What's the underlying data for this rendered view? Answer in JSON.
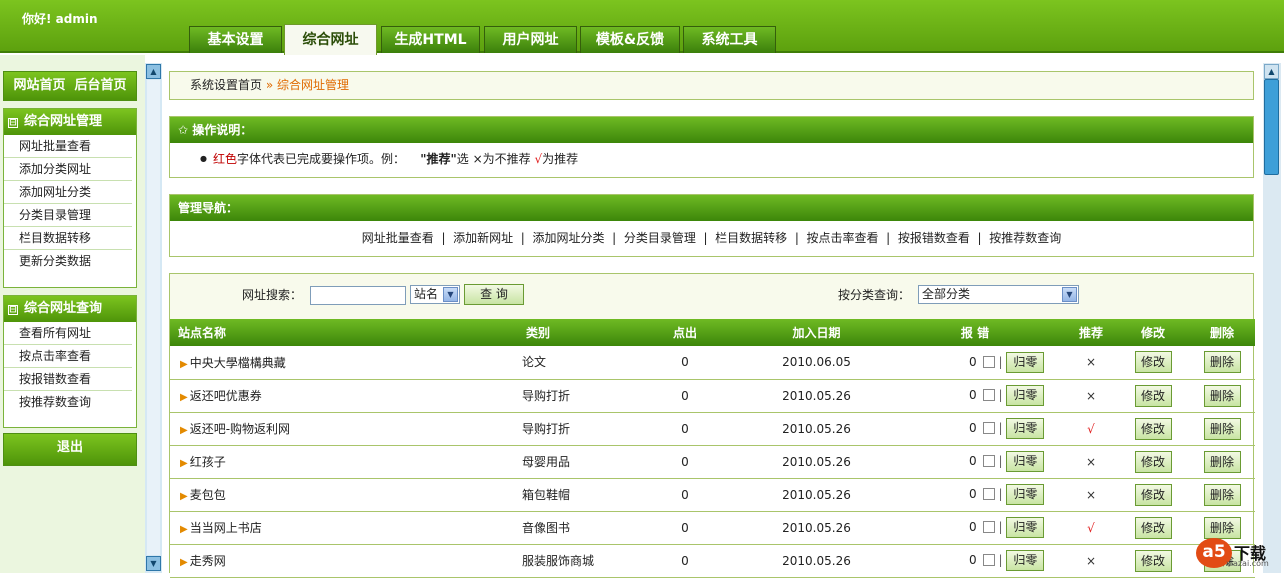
{
  "header": {
    "greeting": "你好! admin",
    "tabs": [
      {
        "label": "基本设置",
        "active": false
      },
      {
        "label": "综合网址",
        "active": true
      },
      {
        "label": "生成HTML",
        "active": false
      },
      {
        "label": "用户网址",
        "active": false
      },
      {
        "label": "模板&反馈",
        "active": false
      },
      {
        "label": "系统工具",
        "active": false
      }
    ]
  },
  "sidebar": {
    "top_links": {
      "site_home": "网站首页",
      "admin_home": "后台首页"
    },
    "group1": {
      "title": "综合网址管理",
      "toggle": "⊟",
      "items": [
        "网址批量查看",
        "添加分类网址",
        "添加网址分类",
        "分类目录管理",
        "栏目数据转移",
        "更新分类数据"
      ]
    },
    "group2": {
      "title": "综合网址查询",
      "toggle": "⊟",
      "items": [
        "查看所有网址",
        "按点击率查看",
        "按报错数查看",
        "按推荐数查询"
      ]
    },
    "logout": "退出"
  },
  "breadcrumb": {
    "home": "系统设置首页",
    "sep": "»",
    "current": "综合网址管理"
  },
  "instructions": {
    "title": "✩ 操作说明：",
    "bullet": "●",
    "red_word": "红色",
    "text1": "字体代表已完成要操作项。例：",
    "bold_word": "\"推荐\"",
    "text2": "选 ×为不推荐",
    "check": "√",
    "text3": "为推荐"
  },
  "manage_nav": {
    "title": "管理导航：",
    "sep": "|",
    "links": [
      "网址批量查看",
      "添加新网址",
      "添加网址分类",
      "分类目录管理",
      "栏目数据转移",
      "按点击率查看",
      "按报错数查看",
      "按推荐数查询"
    ]
  },
  "search": {
    "label": "网址搜索：",
    "input_value": "",
    "field_select": "站名",
    "button": "查 询",
    "category_label": "按分类查询：",
    "category_select": "全部分类"
  },
  "table": {
    "columns": [
      "站点名称",
      "类别",
      "点出",
      "加入日期",
      "报 错",
      "推荐",
      "修改",
      "删除"
    ],
    "reset_label": "归零",
    "edit_label": "修改",
    "delete_label": "删除",
    "bar_char": "|",
    "rows": [
      {
        "name": "中央大學檔構典藏",
        "category": "论文",
        "clicks": "0",
        "date": "2010.06.05",
        "errors": "0",
        "recommend": "×",
        "rec_color": "#333333"
      },
      {
        "name": "返还吧优惠券",
        "category": "导购打折",
        "clicks": "0",
        "date": "2010.05.26",
        "errors": "0",
        "recommend": "×",
        "rec_color": "#333333"
      },
      {
        "name": "返还吧-购物返利网",
        "category": "导购打折",
        "clicks": "0",
        "date": "2010.05.26",
        "errors": "0",
        "recommend": "√",
        "rec_color": "#e02020"
      },
      {
        "name": "红孩子",
        "category": "母婴用品",
        "clicks": "0",
        "date": "2010.05.26",
        "errors": "0",
        "recommend": "×",
        "rec_color": "#333333"
      },
      {
        "name": "麦包包",
        "category": "箱包鞋帽",
        "clicks": "0",
        "date": "2010.05.26",
        "errors": "0",
        "recommend": "×",
        "rec_color": "#333333"
      },
      {
        "name": "当当网上书店",
        "category": "音像图书",
        "clicks": "0",
        "date": "2010.05.26",
        "errors": "0",
        "recommend": "√",
        "rec_color": "#e02020"
      },
      {
        "name": "走秀网",
        "category": "服装服饰商城",
        "clicks": "0",
        "date": "2010.05.26",
        "errors": "0",
        "recommend": "×",
        "rec_color": "#333333"
      }
    ]
  },
  "watermark": {
    "logo": "a5",
    "text": "下载",
    "sub": "xiazai.com"
  },
  "colors": {
    "brand_green": "#5da10e",
    "accent_orange": "#e06a00",
    "check_red": "#e02020"
  }
}
